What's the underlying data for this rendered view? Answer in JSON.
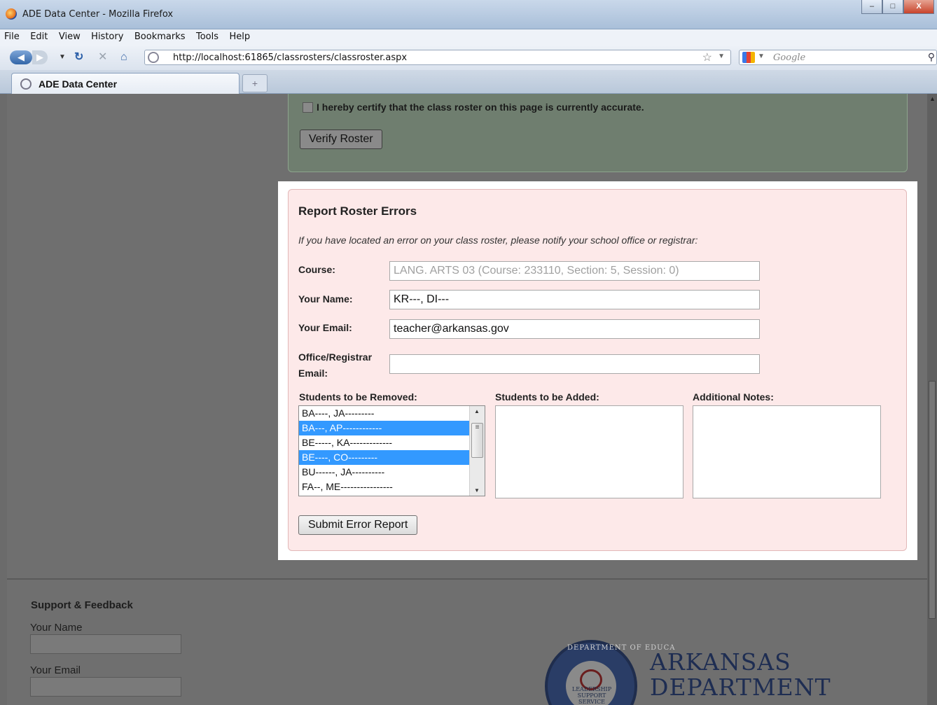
{
  "window": {
    "title": "ADE Data Center - Mozilla Firefox",
    "minimize": "–",
    "maximize": "□",
    "close": "X"
  },
  "menu": [
    "File",
    "Edit",
    "View",
    "History",
    "Bookmarks",
    "Tools",
    "Help"
  ],
  "nav": {
    "url": "http://localhost:61865/classrosters/classroster.aspx",
    "search_engine": "Google"
  },
  "tabs": [
    {
      "label": "ADE Data Center"
    }
  ],
  "verify": {
    "certify_text": "I hereby certify that the class roster on this page is currently accurate.",
    "certified": false,
    "button": "Verify Roster"
  },
  "report": {
    "title": "Report Roster Errors",
    "intro": "If you have located an error on your class roster, please notify your school office or registrar:",
    "fields": {
      "course": {
        "label": "Course:",
        "value": "LANG. ARTS 03 (Course: 233110, Section: 5, Session: 0)"
      },
      "name": {
        "label": "Your Name:",
        "value": "KR---, DI---"
      },
      "email": {
        "label": "Your Email:",
        "value": "teacher@arkansas.gov"
      },
      "office_label_1": "Office/Registrar",
      "office_label_2": "Email:",
      "office_value": ""
    },
    "removed_label": "Students to be Removed:",
    "added_label": "Students to be Added:",
    "notes_label": "Additional Notes:",
    "students": [
      {
        "name": "BA----, JA---------",
        "selected": false
      },
      {
        "name": "BA---, AP------------",
        "selected": true
      },
      {
        "name": "BE-----, KA-------------",
        "selected": false
      },
      {
        "name": "BE----, CO---------",
        "selected": true
      },
      {
        "name": "BU------, JA----------",
        "selected": false
      },
      {
        "name": "FA--, ME----------------",
        "selected": false
      }
    ],
    "submit": "Submit Error Report"
  },
  "footer": {
    "title": "Support & Feedback",
    "name_label": "Your Name",
    "email_label": "Your Email",
    "org_line1": "ARKANSAS",
    "org_line2": "DEPARTMENT",
    "seal_ring": "DEPARTMENT OF EDUCA",
    "seal_center_1": "LEADERSHIP",
    "seal_center_2": "SUPPORT",
    "seal_center_3": "SERVICE"
  }
}
